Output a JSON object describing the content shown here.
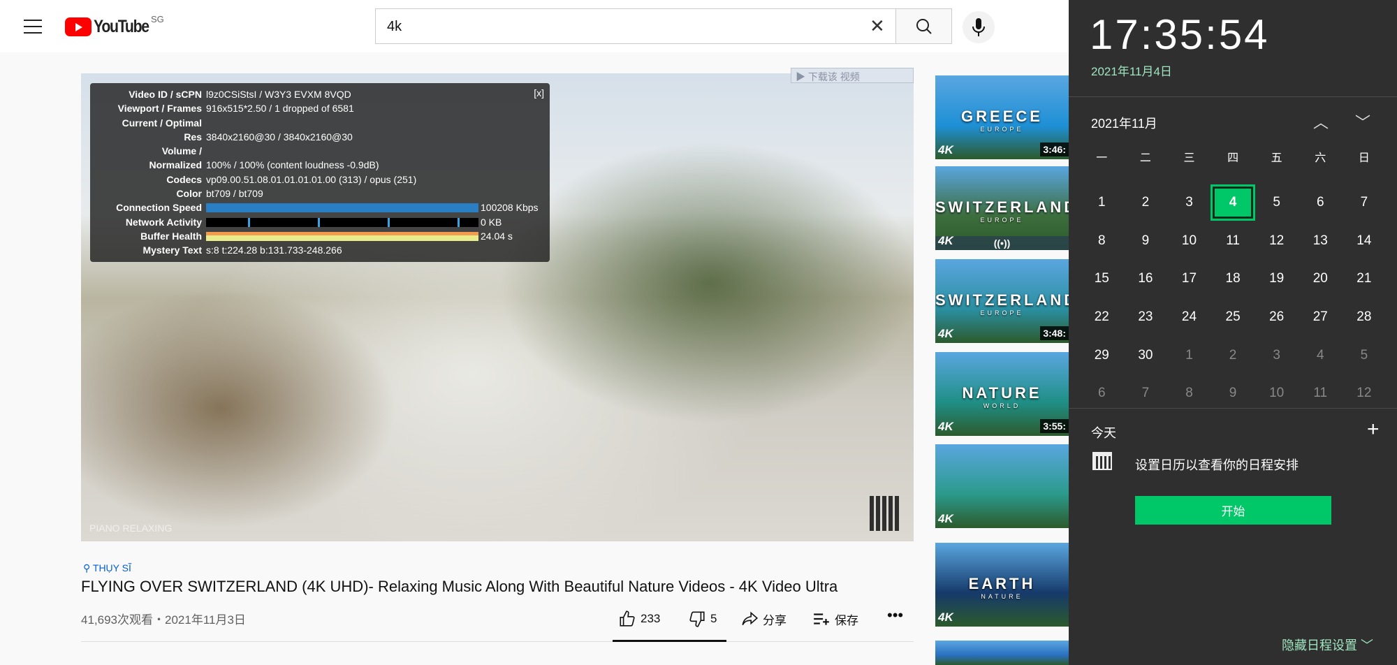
{
  "header": {
    "logo_text": "YouTube",
    "region": "SG",
    "search_value": "4k"
  },
  "player": {
    "download_label": "下载该 视频",
    "watermark": "PIANO RELAXING",
    "close_stats": "[x]",
    "stats": [
      {
        "label": "Video ID / sCPN",
        "value": "l9z0CSiStsI / W3Y3 EVXM 8VQD"
      },
      {
        "label": "Viewport / Frames",
        "value": "916x515*2.50 / 1 dropped of 6581"
      },
      {
        "label": "Current / Optimal",
        "value": ""
      },
      {
        "label": "Res",
        "value": "3840x2160@30 / 3840x2160@30"
      },
      {
        "label": "Volume /",
        "value": ""
      },
      {
        "label": "Normalized",
        "value": "100% / 100% (content loudness -0.9dB)"
      },
      {
        "label": "Codecs",
        "value": "vp09.00.51.08.01.01.01.01.00 (313) / opus (251)"
      },
      {
        "label": "Color",
        "value": "bt709 / bt709"
      },
      {
        "label": "Connection Speed",
        "value": "100208 Kbps",
        "bar": "speed"
      },
      {
        "label": "Network Activity",
        "value": "0 KB",
        "bar": "network"
      },
      {
        "label": "Buffer Health",
        "value": "24.04 s",
        "bar": "buffer"
      },
      {
        "label": "Mystery Text",
        "value": "s:8 t:224.28 b:131.733-248.266"
      }
    ]
  },
  "video": {
    "location": "THỤY SĨ",
    "title": "FLYING OVER SWITZERLAND (4K UHD)- Relaxing Music Along With Beautiful Nature Videos - 4K Video Ultra",
    "views_date": "41,693次观看・2021年11月3日",
    "likes": "233",
    "dislikes": "5",
    "share": "分享",
    "save": "保存"
  },
  "recommended": [
    {
      "title": "GREECE",
      "sub": "EUROPE",
      "duration": "3:46:",
      "bg": "#1e90d6"
    },
    {
      "title": "SWITZERLAND",
      "sub": "EUROPE",
      "duration": "",
      "live": "((•))",
      "bg": "#3c6d3c"
    },
    {
      "title": "SWITZERLAND",
      "sub": "EUROPE",
      "duration": "3:48:",
      "bg": "#2a8fa0"
    },
    {
      "title": "NATURE",
      "sub": "WORLD",
      "duration": "3:55:",
      "bg": "#1f8f86"
    },
    {
      "title": "",
      "sub": "",
      "duration": "",
      "bg": "#2b9a8a"
    },
    {
      "title": "EARTH",
      "sub": "NATURE",
      "duration": "",
      "bg": "#163a6a"
    },
    {
      "title": "",
      "sub": "",
      "duration": "",
      "bg": "#2a70c0"
    }
  ],
  "calendar": {
    "time": "17:35:54",
    "date": "2021年11月4日",
    "month": "2021年11月",
    "weekdays": [
      "一",
      "二",
      "三",
      "四",
      "五",
      "六",
      "日"
    ],
    "days": [
      "1",
      "2",
      "3",
      "4",
      "5",
      "6",
      "7",
      "8",
      "9",
      "10",
      "11",
      "12",
      "13",
      "14",
      "15",
      "16",
      "17",
      "18",
      "19",
      "20",
      "21",
      "22",
      "23",
      "24",
      "25",
      "26",
      "27",
      "28",
      "29",
      "30",
      "1",
      "2",
      "3",
      "4",
      "5",
      "6",
      "7",
      "8",
      "9",
      "10",
      "11",
      "12"
    ],
    "today": "4",
    "today_label": "今天",
    "info": "设置日历以查看你的日程安排",
    "start": "开始",
    "hide": "隐藏日程设置",
    "accent": "#00c767"
  }
}
